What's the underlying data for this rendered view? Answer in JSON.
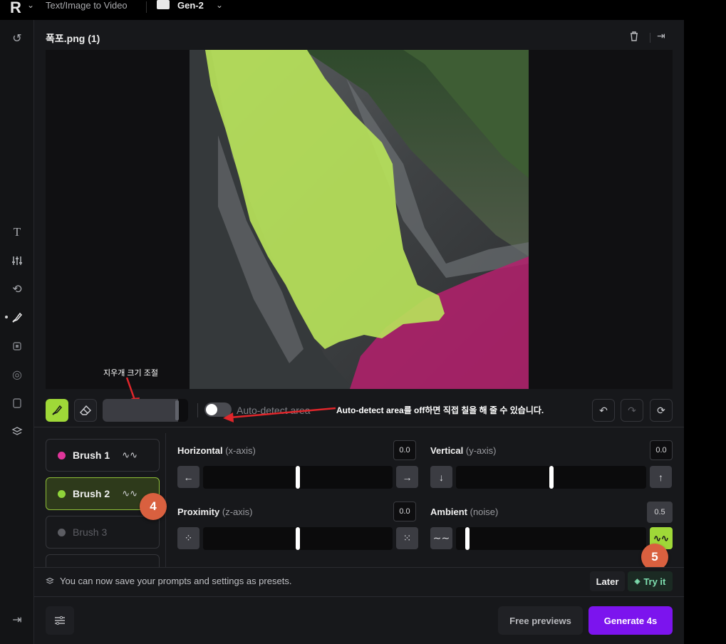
{
  "topbar": {
    "app_logo": "R",
    "mode_label": "Text/Image to Video",
    "project_label": "Gen-2"
  },
  "panel": {
    "file_title": "폭포.png (1)"
  },
  "annotations": {
    "eraser_size": "지우개 크기 조절",
    "auto_detect_note": "Auto-detect area를 off하면 직접 칠을 해 줄 수 있습니다."
  },
  "toolbar": {
    "auto_detect_label": "Auto-detect area",
    "auto_detect_on": false
  },
  "brushes": [
    {
      "label": "Brush 1",
      "color": "#e0359a",
      "state": "normal"
    },
    {
      "label": "Brush 2",
      "color": "#8fd43a",
      "state": "selected"
    },
    {
      "label": "Brush 3",
      "color": "#5c5d63",
      "state": "disabled"
    }
  ],
  "motion": {
    "horizontal": {
      "label": "Horizontal",
      "axis": "(x-axis)",
      "value": "0.0"
    },
    "vertical": {
      "label": "Vertical",
      "axis": "(y-axis)",
      "value": "0.0"
    },
    "proximity": {
      "label": "Proximity",
      "axis": "(z-axis)",
      "value": "0.0"
    },
    "ambient": {
      "label": "Ambient",
      "axis": "(noise)",
      "value": "0.5"
    }
  },
  "badges": {
    "step4": "4",
    "step5": "5"
  },
  "preset_banner": {
    "text": "You can now save your prompts and settings as presets.",
    "later": "Later",
    "try_it": "Try it"
  },
  "footer": {
    "free_previews": "Free previews",
    "generate": "Generate 4s"
  },
  "colors": {
    "accent_green": "#9fd838",
    "accent_purple": "#7c14ee",
    "mask_green": "#b7e25a",
    "mask_magenta": "#b5206d"
  }
}
